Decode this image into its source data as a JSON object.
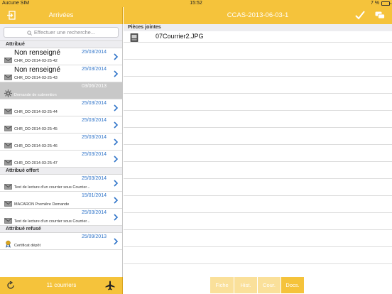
{
  "status_bar": {
    "carrier": "Aucune SIM",
    "time": "15:52",
    "battery": "7 %"
  },
  "left_nav": {
    "title": "Arrivées"
  },
  "right_nav": {
    "title": "CCAS-2013-06-03-1"
  },
  "search": {
    "placeholder": "Effectuer une recherche..."
  },
  "sections": [
    {
      "title": "Attribué",
      "rows": [
        {
          "icon": "mail-icon",
          "title": "Non renseigné",
          "subtitle": "CHR_DD-2014-03-25-42",
          "date": "25/03/2014",
          "selected": false
        },
        {
          "icon": "mail-icon",
          "title": "Non renseigné",
          "subtitle": "CHR_DD-2014-03-25-43",
          "date": "25/03/2014",
          "selected": false
        },
        {
          "icon": "gear-icon",
          "title": "",
          "subtitle": "Demande de subvention",
          "date": "03/06/2013",
          "selected": true
        },
        {
          "icon": "mail-icon",
          "title": "",
          "subtitle": "CHR_DD-2014-03-25-44",
          "date": "25/03/2014",
          "selected": false
        },
        {
          "icon": "mail-icon",
          "title": "",
          "subtitle": "CHR_DD-2014-03-25-45",
          "date": "25/03/2014",
          "selected": false
        },
        {
          "icon": "mail-icon",
          "title": "",
          "subtitle": "CHR_DD-2014-03-25-46",
          "date": "25/03/2014",
          "selected": false
        },
        {
          "icon": "mail-icon",
          "title": "",
          "subtitle": "CHR_DD-2014-03-25-47",
          "date": "25/03/2014",
          "selected": false
        }
      ]
    },
    {
      "title": "Attribué offert",
      "rows": [
        {
          "icon": "mail-icon",
          "title": "",
          "subtitle": "Test de lecture d'un courrier sous Courrier...",
          "date": "25/03/2014",
          "selected": false
        },
        {
          "icon": "mail-icon",
          "title": "",
          "subtitle": "MACARON Première Demande",
          "date": "15/01/2014",
          "selected": false
        },
        {
          "icon": "mail-icon",
          "title": "",
          "subtitle": "Test de lecture d'un courrier sous Courrier...",
          "date": "25/03/2014",
          "selected": false
        }
      ]
    },
    {
      "title": "Attribué refusé",
      "rows": [
        {
          "icon": "certificate-icon",
          "title": "",
          "subtitle": "Certificat dépôt",
          "date": "25/09/2013",
          "selected": false
        }
      ]
    }
  ],
  "left_toolbar": {
    "count_label": "11 courriers"
  },
  "attachments": {
    "header": "Pièces jointes",
    "files": [
      {
        "name": "07Courrier2.JPG",
        "icon": "file-icon"
      }
    ]
  },
  "tabs": [
    {
      "label": "Fiche",
      "active": false
    },
    {
      "label": "Hist.",
      "active": false
    },
    {
      "label": "Cour.",
      "active": false
    },
    {
      "label": "Docs.",
      "active": true
    }
  ],
  "colors": {
    "accent": "#f5c33b",
    "date_blue": "#2f74c9",
    "selected_row": "#c8c8c8"
  }
}
